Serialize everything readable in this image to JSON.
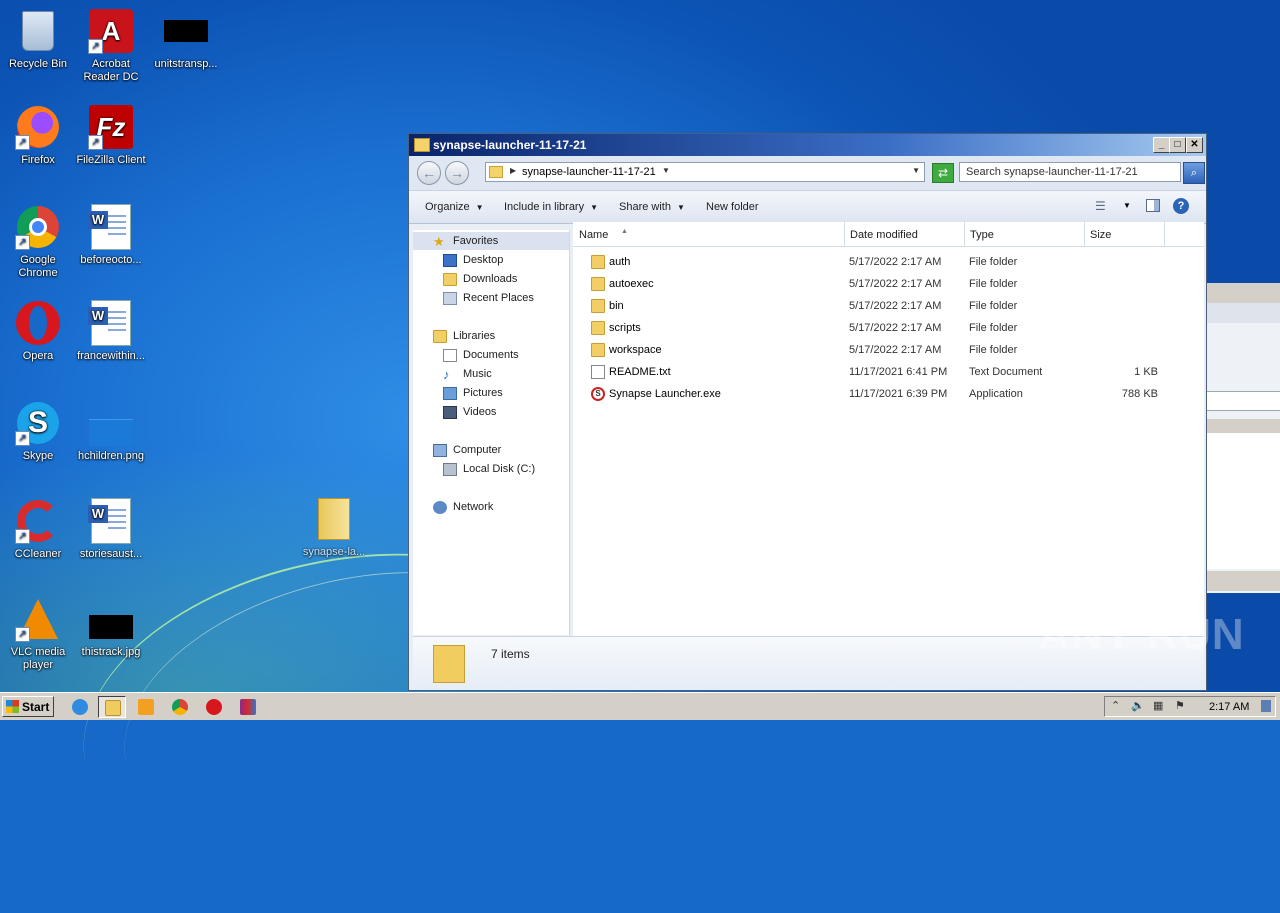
{
  "desktop": {
    "icons": [
      {
        "label": "Recycle Bin"
      },
      {
        "label": "Acrobat Reader DC"
      },
      {
        "label": "unitstransp..."
      },
      {
        "label": "Firefox"
      },
      {
        "label": "FileZilla Client"
      },
      {
        "label": "Google Chrome"
      },
      {
        "label": "beforeocto..."
      },
      {
        "label": "Opera"
      },
      {
        "label": "francewithin..."
      },
      {
        "label": "Skype"
      },
      {
        "label": "hchildren.png"
      },
      {
        "label": "CCleaner"
      },
      {
        "label": "storiesaust..."
      },
      {
        "label": "synapse-la..."
      },
      {
        "label": "VLC media player"
      },
      {
        "label": "thistrack.jpg"
      }
    ]
  },
  "explorer": {
    "title": "synapse-launcher-11-17-21",
    "address": "synapse-launcher-11-17-21",
    "search_placeholder": "Search synapse-launcher-11-17-21",
    "toolbar": {
      "organize": "Organize",
      "include": "Include in library",
      "share": "Share with",
      "new_folder": "New folder"
    },
    "nav": {
      "favorites": "Favorites",
      "desktop": "Desktop",
      "downloads": "Downloads",
      "recent": "Recent Places",
      "libraries": "Libraries",
      "documents": "Documents",
      "music": "Music",
      "pictures": "Pictures",
      "videos": "Videos",
      "computer": "Computer",
      "localdisk": "Local Disk (C:)",
      "network": "Network"
    },
    "columns": {
      "name": "Name",
      "date": "Date modified",
      "type": "Type",
      "size": "Size"
    },
    "files": [
      {
        "name": "auth",
        "date": "5/17/2022 2:17 AM",
        "type": "File folder",
        "size": "",
        "kind": "folder"
      },
      {
        "name": "autoexec",
        "date": "5/17/2022 2:17 AM",
        "type": "File folder",
        "size": "",
        "kind": "folder"
      },
      {
        "name": "bin",
        "date": "5/17/2022 2:17 AM",
        "type": "File folder",
        "size": "",
        "kind": "folder"
      },
      {
        "name": "scripts",
        "date": "5/17/2022 2:17 AM",
        "type": "File folder",
        "size": "",
        "kind": "folder"
      },
      {
        "name": "workspace",
        "date": "5/17/2022 2:17 AM",
        "type": "File folder",
        "size": "",
        "kind": "folder"
      },
      {
        "name": "README.txt",
        "date": "11/17/2021 6:41 PM",
        "type": "Text Document",
        "size": "1 KB",
        "kind": "text"
      },
      {
        "name": "Synapse Launcher.exe",
        "date": "11/17/2021 6:39 PM",
        "type": "Application",
        "size": "788 KB",
        "kind": "exe"
      }
    ],
    "item_count": "7 items"
  },
  "taskbar": {
    "start_label": "Start",
    "clock": "2:17 AM"
  },
  "watermark": "ANY RUN"
}
